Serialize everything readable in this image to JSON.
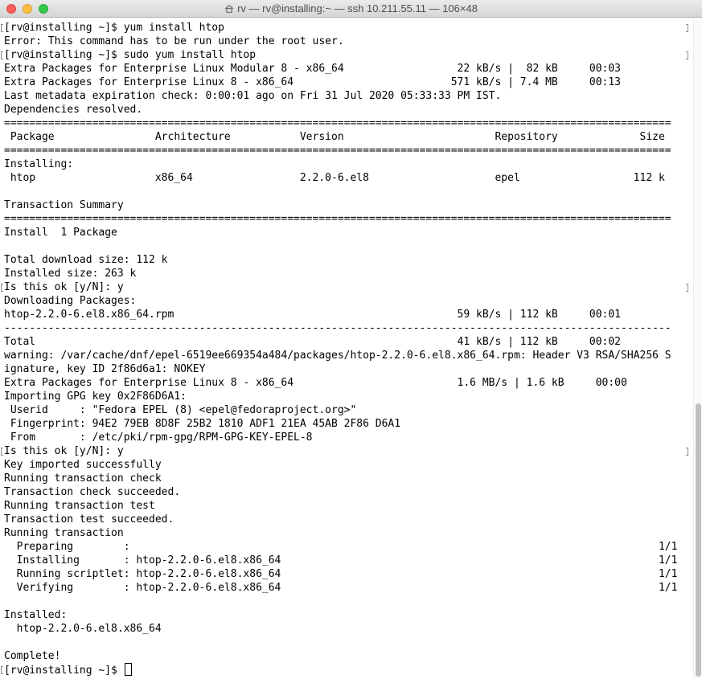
{
  "window": {
    "title": "rv — rv@installing:~ — ssh 10.211.55.11 — 106×48",
    "title_icon": "home-folder-icon",
    "colors": {
      "close": "#fc605c",
      "minimize": "#fdbc40",
      "maximize": "#34c84a"
    }
  },
  "terminal": {
    "lines": [
      "[rv@installing ~]$ yum install htop",
      "Error: This command has to be run under the root user.",
      "[rv@installing ~]$ sudo yum install htop",
      "Extra Packages for Enterprise Linux Modular 8 - x86_64                  22 kB/s |  82 kB     00:03",
      "Extra Packages for Enterprise Linux 8 - x86_64                         571 kB/s | 7.4 MB     00:13",
      "Last metadata expiration check: 0:00:01 ago on Fri 31 Jul 2020 05:33:33 PM IST.",
      "Dependencies resolved.",
      "==========================================================================================================",
      " Package                Architecture           Version                        Repository             Size",
      "==========================================================================================================",
      "Installing:",
      " htop                   x86_64                 2.2.0-6.el8                    epel                  112 k",
      "",
      "Transaction Summary",
      "==========================================================================================================",
      "Install  1 Package",
      "",
      "Total download size: 112 k",
      "Installed size: 263 k",
      "Is this ok [y/N]: y",
      "Downloading Packages:",
      "htop-2.2.0-6.el8.x86_64.rpm                                             59 kB/s | 112 kB     00:01",
      "----------------------------------------------------------------------------------------------------------",
      "Total                                                                   41 kB/s | 112 kB     00:02",
      "warning: /var/cache/dnf/epel-6519ee669354a484/packages/htop-2.2.0-6.el8.x86_64.rpm: Header V3 RSA/SHA256 S",
      "ignature, key ID 2f86d6a1: NOKEY",
      "Extra Packages for Enterprise Linux 8 - x86_64                          1.6 MB/s | 1.6 kB     00:00",
      "Importing GPG key 0x2F86D6A1:",
      " Userid     : \"Fedora EPEL (8) <epel@fedoraproject.org>\"",
      " Fingerprint: 94E2 79EB 8D8F 25B2 1810 ADF1 21EA 45AB 2F86 D6A1",
      " From       : /etc/pki/rpm-gpg/RPM-GPG-KEY-EPEL-8",
      "Is this ok [y/N]: y",
      "Key imported successfully",
      "Running transaction check",
      "Transaction check succeeded.",
      "Running transaction test",
      "Transaction test succeeded.",
      "Running transaction",
      "  Preparing        :                                                                                    1/1",
      "  Installing       : htop-2.2.0-6.el8.x86_64                                                            1/1",
      "  Running scriptlet: htop-2.2.0-6.el8.x86_64                                                            1/1",
      "  Verifying        : htop-2.2.0-6.el8.x86_64                                                            1/1",
      "",
      "Installed:",
      "  htop-2.2.0-6.el8.x86_64",
      "",
      "Complete!"
    ],
    "prompt": "[rv@installing ~]$ "
  }
}
